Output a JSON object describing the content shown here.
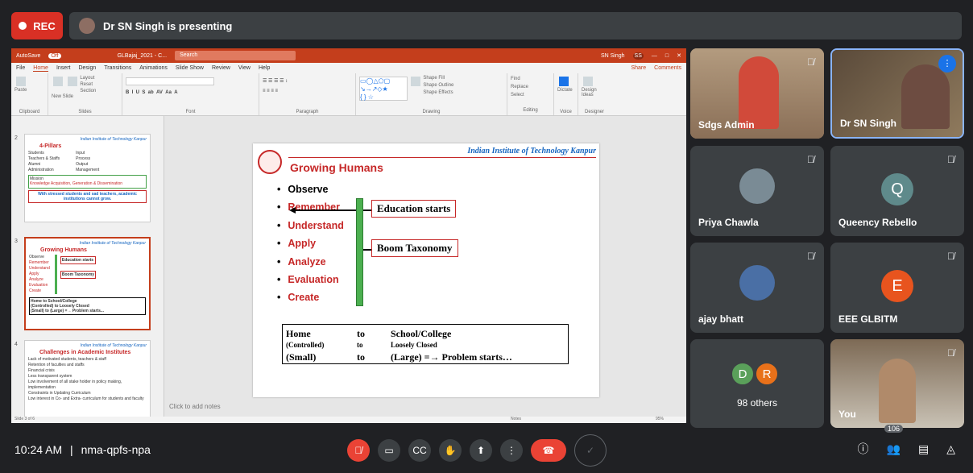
{
  "meeting": {
    "rec_label": "REC",
    "presenting_label": "Dr SN Singh is presenting",
    "time": "10:24 AM",
    "separator": "|",
    "meeting_code": "nma-qpfs-npa",
    "participants_count": "106"
  },
  "ppt": {
    "autosave": "AutoSave",
    "autosave_state": "Off",
    "file_name": "GLBajaj_2021 - C...",
    "search_placeholder": "Search",
    "user_name": "SN Singh",
    "user_initials": "SS",
    "menu": [
      "File",
      "Home",
      "Insert",
      "Design",
      "Transitions",
      "Animations",
      "Slide Show",
      "Review",
      "View",
      "Help"
    ],
    "share": "Share",
    "comments": "Comments",
    "ribbon_groups": [
      "Clipboard",
      "Slides",
      "Font",
      "Paragraph",
      "Drawing",
      "Editing",
      "Voice",
      "Designer"
    ],
    "ribbon_items": {
      "paste": "Paste",
      "new_slide": "New Slide",
      "reuse_slides": "Reuse Slides",
      "layout": "Layout",
      "reset": "Reset",
      "section": "Section",
      "arrange": "Arrange",
      "quick_styles": "Quick Styles",
      "shape_fill": "Shape Fill",
      "shape_outline": "Shape Outline",
      "shape_effects": "Shape Effects",
      "find": "Find",
      "replace": "Replace",
      "select": "Select",
      "dictate": "Dictate",
      "design_ideas": "Design Ideas"
    },
    "notes_placeholder": "Click to add notes",
    "slide_counter": "Slide 3 of 6",
    "notes_btn": "Notes",
    "zoom": "95%"
  },
  "thumbs": [
    {
      "num": "2",
      "title": "4-Pillars",
      "header": "Indian Institute of Technology Kanpur",
      "bullets": [
        "Students",
        "Teachers & Staffs",
        "Alumni",
        "Administration"
      ],
      "boxes": [
        "Input",
        "Process",
        "Output",
        "Management"
      ],
      "mission_label": "Mission",
      "mission": "Knowledge Acquisition, Generation & Dissemination",
      "note": "With stressed students and sad teachers, academic institutions cannot grow."
    },
    {
      "num": "3",
      "title": "Growing Humans",
      "header": "Indian Institute of Technology Kanpur",
      "bullets": [
        "Observe",
        "Remember",
        "Understand",
        "Apply",
        "Analyze",
        "Evaluation",
        "Create"
      ],
      "box1": "Education starts",
      "box2": "Boom Taxonomy",
      "r1": [
        "Home",
        "to",
        "School/College"
      ],
      "r2": [
        "(Controlled)",
        "to",
        "Loosely Closed"
      ],
      "r3": [
        "(Small)",
        "to",
        "(Large) =→ Problem starts..."
      ]
    },
    {
      "num": "4",
      "title": "Challenges in Academic Institutes",
      "header": "Indian Institute of Technology Kanpur",
      "bullets": [
        "Lack of motivated students, teachers & staff",
        "Retention of faculties and staffs",
        "Financial crisis",
        "Less transparent system",
        "Low involvement of all stake holder in policy making, implementation",
        "Constraints in Updating Curriculum",
        "Low interest in Co- and Extra- curriculum for students and faculty"
      ]
    }
  ],
  "slide": {
    "institute": "Indian Institute of Technology Kanpur",
    "title": "Growing Humans",
    "bullets": [
      "Observe",
      "Remember",
      "Understand",
      "Apply",
      "Analyze",
      "Evaluation",
      "Create"
    ],
    "callout1": "Education starts",
    "callout2": "Boom Taxonomy",
    "row1": [
      "Home",
      "to",
      "School/College"
    ],
    "row2": [
      "(Controlled)",
      "to",
      "Loosely Closed"
    ],
    "row3": [
      "(Small)",
      "to",
      "(Large) =→ Problem starts…"
    ]
  },
  "tiles": [
    {
      "name": "Sdgs Admin"
    },
    {
      "name": "Dr SN Singh"
    },
    {
      "name": "Priya Chawla"
    },
    {
      "name": "Queency Rebello",
      "letter": "Q",
      "color": "#5f8a8b"
    },
    {
      "name": "ajay bhatt"
    },
    {
      "name": "EEE GLBITM",
      "letter": "E",
      "color": "#e8541e"
    },
    {
      "name": "98 others",
      "letters": [
        "D",
        "R"
      ],
      "colors": [
        "#5aa05a",
        "#e8711a"
      ]
    },
    {
      "name": "You"
    }
  ]
}
